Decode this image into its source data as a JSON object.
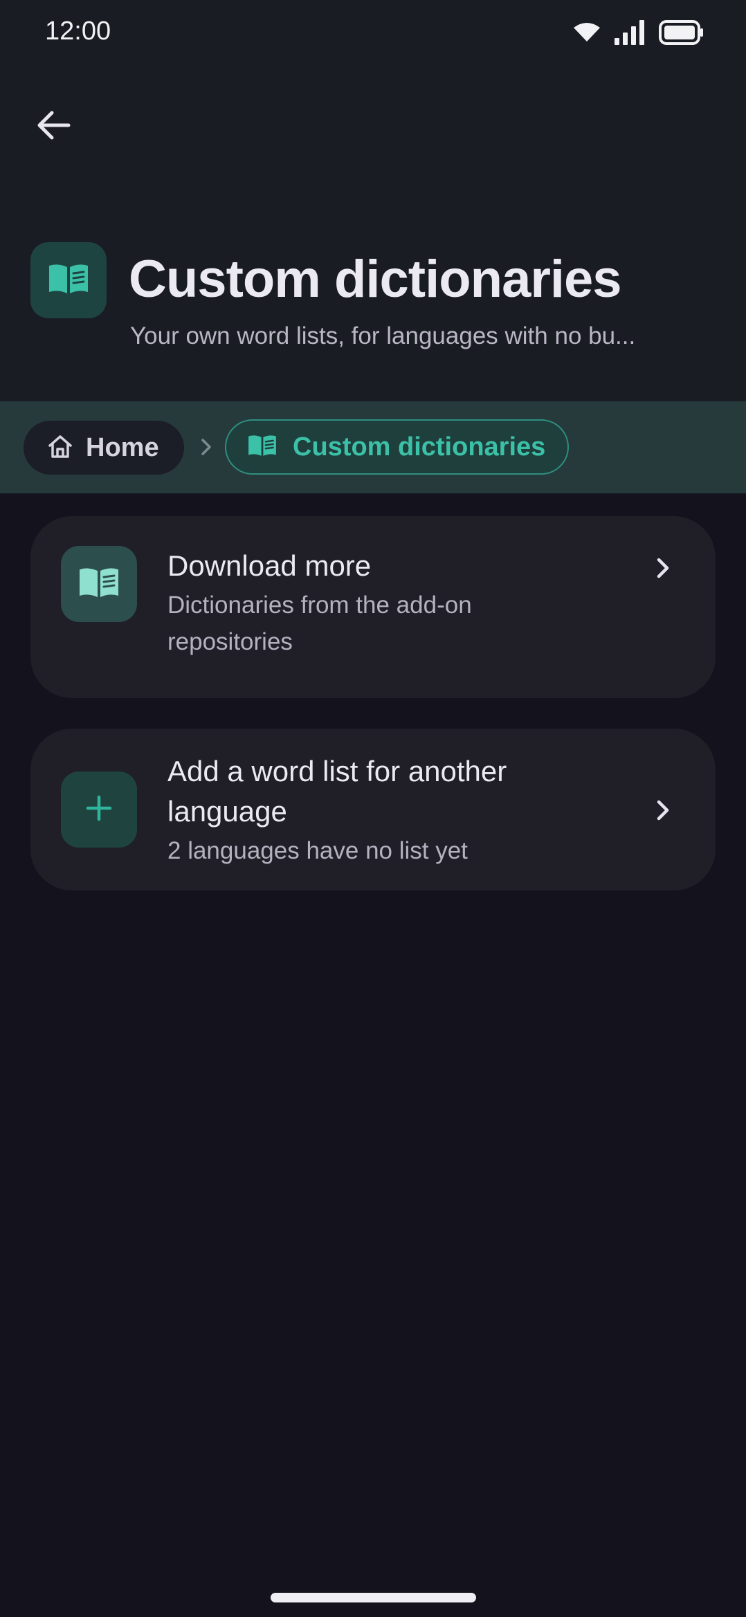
{
  "status_bar": {
    "time": "12:00",
    "icons": [
      "wifi-icon",
      "signal-icon",
      "battery-icon"
    ]
  },
  "header": {
    "back_icon": "arrow-left-icon",
    "icon": "book-icon",
    "title": "Custom dictionaries",
    "subtitle": "Your own word lists, for languages with no bu..."
  },
  "breadcrumb": {
    "items": [
      {
        "label": "Home",
        "icon": "home-icon"
      },
      {
        "label": "Custom dictionaries",
        "icon": "book-icon",
        "active": true
      }
    ],
    "separator_icon": "chevron-right-icon"
  },
  "cards": [
    {
      "icon": "book-icon",
      "title": "Download more",
      "description": "Dictionaries from the add-on repositories"
    },
    {
      "icon": "plus-icon",
      "title": "Add a word list for another language",
      "description": "2 languages have no list yet"
    }
  ],
  "colors": {
    "accent": "#3cc1a9",
    "background": "#13121d",
    "header_background": "#1a1c24",
    "breadcrumb_background": "#263a3c",
    "card_background": "#201f27"
  }
}
